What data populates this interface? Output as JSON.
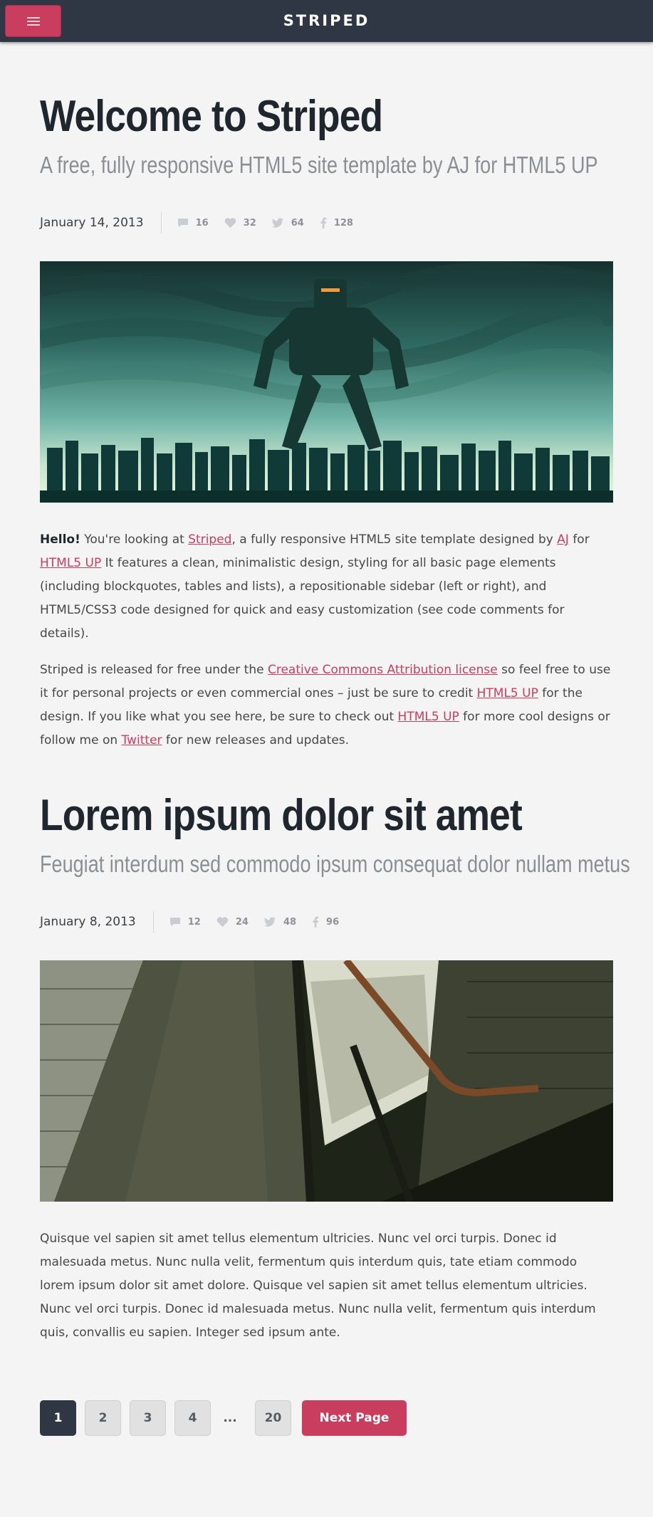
{
  "header": {
    "brand": "STRIPED",
    "menu_icon": "menu-icon"
  },
  "posts": [
    {
      "title": "Welcome to Striped",
      "subtitle": "A free, fully responsive HTML5 site template by AJ for HTML5 UP",
      "date": "January 14, 2013",
      "stats": {
        "comments": "16",
        "likes": "32",
        "tweets": "64",
        "facebook": "128"
      },
      "image_alt": "Giant robot over city skyline",
      "p1": {
        "hello": "Hello!",
        "t1": " You're looking at ",
        "link_striped": "Striped",
        "t2": ", a fully responsive HTML5 site template designed by ",
        "link_aj": "AJ",
        "t3": " for ",
        "link_html5up": "HTML5 UP",
        "t4": " It features a clean, minimalistic design, styling for all basic page elements (including blockquotes, tables and lists), a repositionable sidebar (left or right), and HTML5/CSS3 code designed for quick and easy customization (see code comments for details)."
      },
      "p2": {
        "t1": "Striped is released for free under the ",
        "link_cc": "Creative Commons Attribution license",
        "t2": " so feel free to use it for personal projects or even commercial ones – just be sure to credit ",
        "link_html5up": "HTML5 UP",
        "t3": " for the design. If you like what you see here, be sure to check out ",
        "link_html5up2": "HTML5 UP",
        "t4": " for more cool designs or follow me on ",
        "link_twitter": "Twitter",
        "t5": " for new releases and updates."
      }
    },
    {
      "title": "Lorem ipsum dolor sit amet",
      "subtitle": "Feugiat interdum sed commodo ipsum consequat dolor nullam metus",
      "date": "January 8, 2013",
      "stats": {
        "comments": "12",
        "likes": "24",
        "tweets": "48",
        "facebook": "96"
      },
      "image_alt": "Concrete stairwell with handrail",
      "p1": "Quisque vel sapien sit amet tellus elementum ultricies. Nunc vel orci turpis. Donec id malesuada metus. Nunc nulla velit, fermentum quis interdum quis, tate etiam commodo lorem ipsum dolor sit amet dolore. Quisque vel sapien sit amet tellus elementum ultricies. Nunc vel orci turpis. Donec id malesuada metus. Nunc nulla velit, fermentum quis interdum quis, convallis eu sapien. Integer sed ipsum ante."
    }
  ],
  "pagination": {
    "pages": [
      "1",
      "2",
      "3",
      "4"
    ],
    "ellipsis": "...",
    "last": "20",
    "next": "Next Page",
    "current": "1"
  },
  "colors": {
    "accent": "#c93d5e",
    "dark": "#2e3743",
    "background": "#f4f4f4"
  }
}
